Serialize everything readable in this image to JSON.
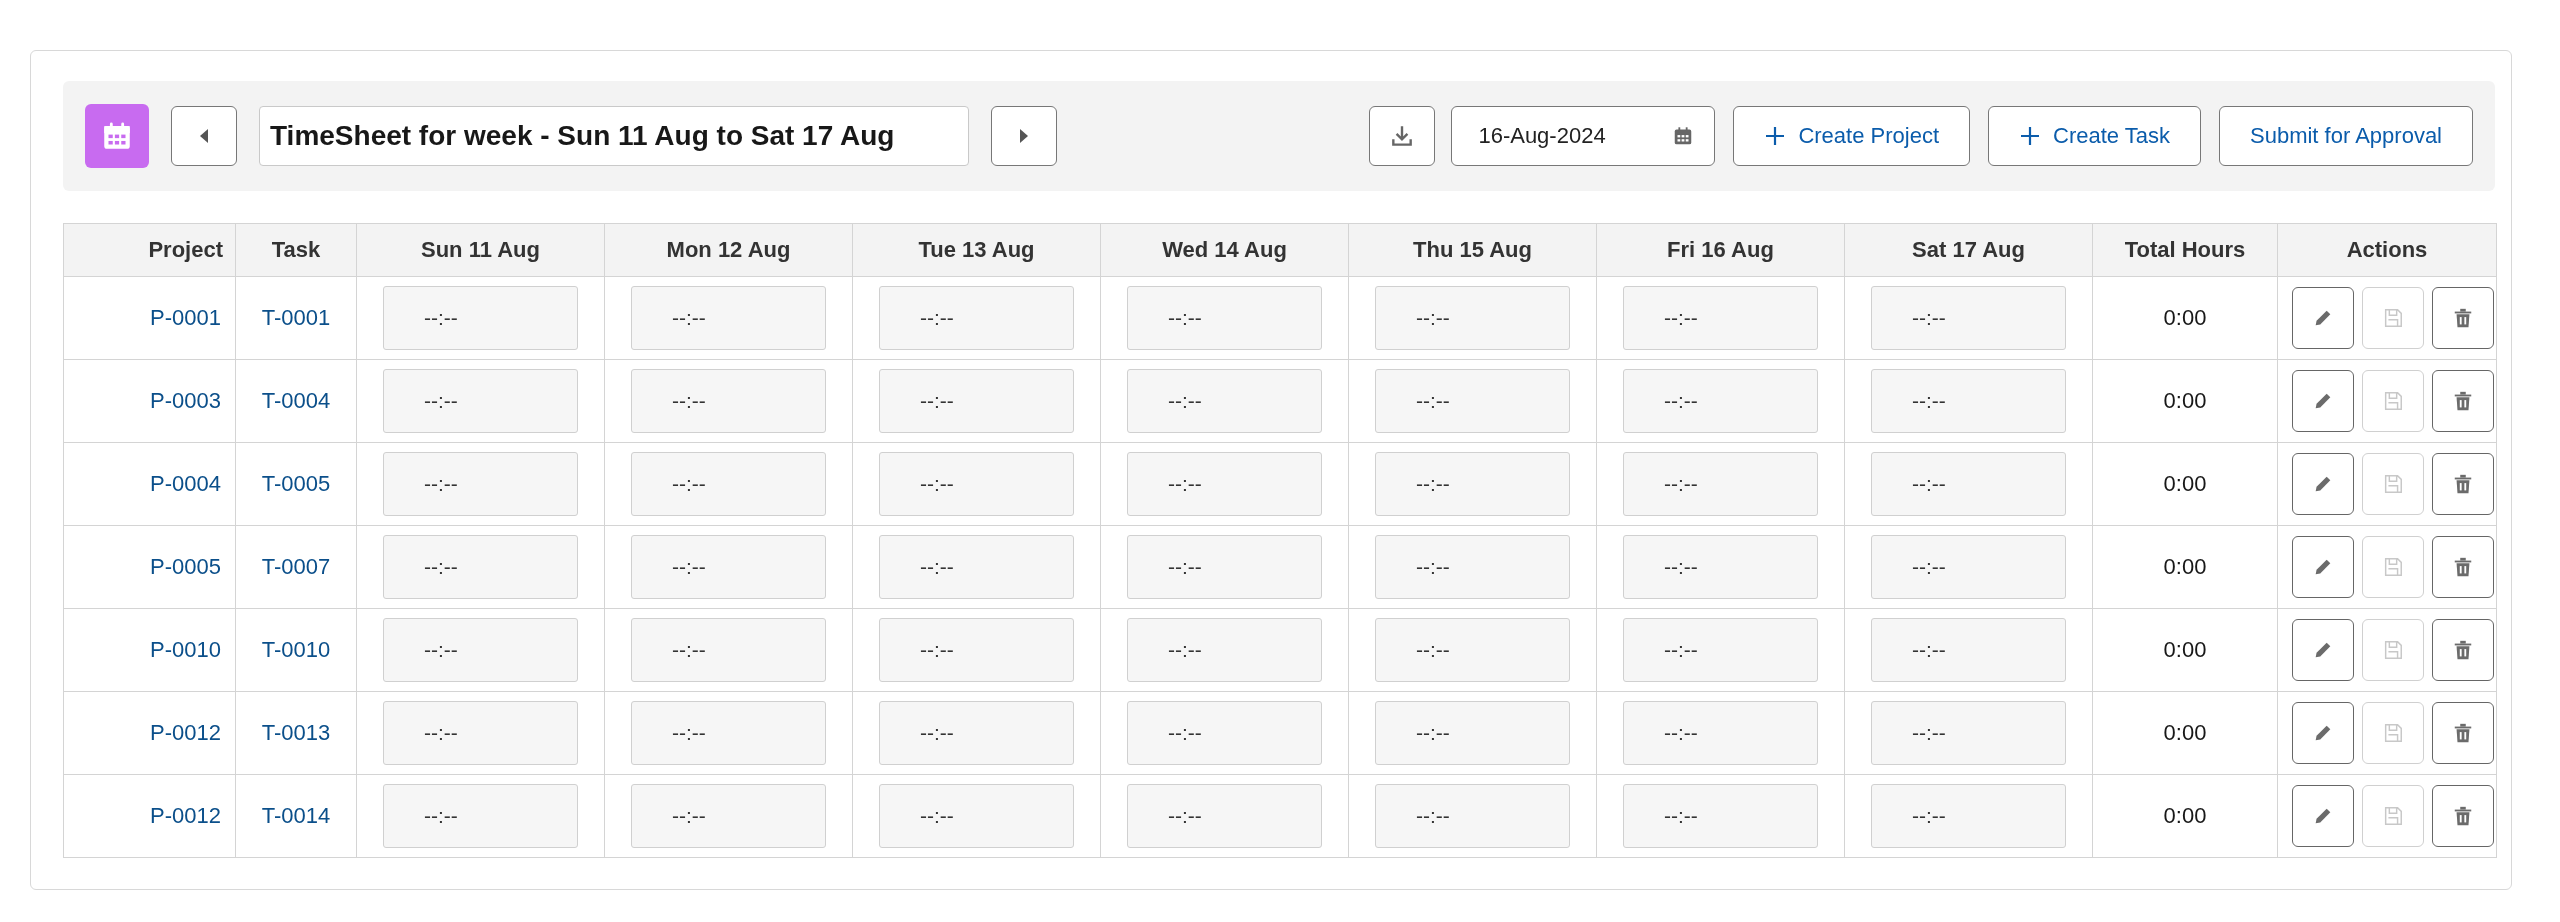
{
  "toolbar": {
    "title": "TimeSheet for week - Sun 11 Aug to Sat 17 Aug",
    "date": "16-Aug-2024",
    "buttons": [
      {
        "label": "Create Project",
        "kind": "add"
      },
      {
        "label": "Create Task",
        "kind": "add"
      },
      {
        "label": "Submit for Approval",
        "kind": "plain"
      }
    ]
  },
  "table": {
    "columns": [
      "Project",
      "Task",
      "Sun 11 Aug",
      "Mon 12 Aug",
      "Tue 13 Aug",
      "Wed 14 Aug",
      "Thu 15 Aug",
      "Fri 16 Aug",
      "Sat 17 Aug",
      "Total Hours",
      "Actions"
    ],
    "rows": [
      {
        "project": "P-0001",
        "task": "T-0001",
        "hours": [
          "--:--",
          "--:--",
          "--:--",
          "--:--",
          "--:--",
          "--:--",
          "--:--"
        ],
        "total": "0:00",
        "actions": [
          {
            "kind": "edit",
            "disabled": false
          },
          {
            "kind": "save",
            "disabled": true
          },
          {
            "kind": "delete",
            "disabled": false
          }
        ]
      },
      {
        "project": "P-0003",
        "task": "T-0004",
        "hours": [
          "--:--",
          "--:--",
          "--:--",
          "--:--",
          "--:--",
          "--:--",
          "--:--"
        ],
        "total": "0:00",
        "actions": [
          {
            "kind": "edit",
            "disabled": false
          },
          {
            "kind": "save",
            "disabled": true
          },
          {
            "kind": "delete",
            "disabled": false
          }
        ]
      },
      {
        "project": "P-0004",
        "task": "T-0005",
        "hours": [
          "--:--",
          "--:--",
          "--:--",
          "--:--",
          "--:--",
          "--:--",
          "--:--"
        ],
        "total": "0:00",
        "actions": [
          {
            "kind": "edit",
            "disabled": false
          },
          {
            "kind": "save",
            "disabled": true
          },
          {
            "kind": "delete",
            "disabled": false
          }
        ]
      },
      {
        "project": "P-0005",
        "task": "T-0007",
        "hours": [
          "--:--",
          "--:--",
          "--:--",
          "--:--",
          "--:--",
          "--:--",
          "--:--"
        ],
        "total": "0:00",
        "actions": [
          {
            "kind": "edit",
            "disabled": false
          },
          {
            "kind": "save",
            "disabled": true
          },
          {
            "kind": "delete",
            "disabled": false
          }
        ]
      },
      {
        "project": "P-0010",
        "task": "T-0010",
        "hours": [
          "--:--",
          "--:--",
          "--:--",
          "--:--",
          "--:--",
          "--:--",
          "--:--"
        ],
        "total": "0:00",
        "actions": [
          {
            "kind": "edit",
            "disabled": false
          },
          {
            "kind": "save",
            "disabled": true
          },
          {
            "kind": "delete",
            "disabled": false
          }
        ]
      },
      {
        "project": "P-0012",
        "task": "T-0013",
        "hours": [
          "--:--",
          "--:--",
          "--:--",
          "--:--",
          "--:--",
          "--:--",
          "--:--"
        ],
        "total": "0:00",
        "actions": [
          {
            "kind": "edit",
            "disabled": false
          },
          {
            "kind": "save",
            "disabled": true
          },
          {
            "kind": "delete",
            "disabled": false
          }
        ]
      },
      {
        "project": "P-0012",
        "task": "T-0014",
        "hours": [
          "--:--",
          "--:--",
          "--:--",
          "--:--",
          "--:--",
          "--:--",
          "--:--"
        ],
        "total": "0:00",
        "actions": [
          {
            "kind": "edit",
            "disabled": false
          },
          {
            "kind": "save",
            "disabled": true
          },
          {
            "kind": "delete",
            "disabled": false
          }
        ]
      }
    ]
  }
}
